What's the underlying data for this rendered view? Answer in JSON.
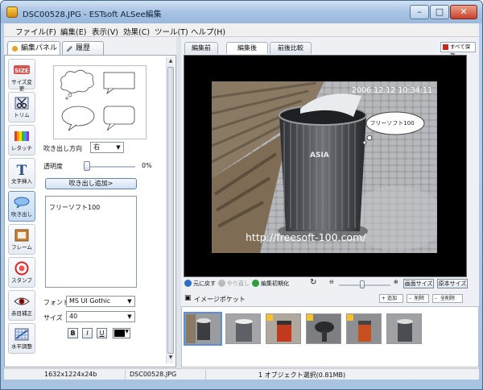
{
  "window": {
    "title": "DSC00528.JPG - ESTsoft ALSee編集",
    "buttons": {
      "minimize": "–",
      "maximize": "□",
      "close": "✕"
    }
  },
  "menu": [
    "ファイル(F)",
    "編集(E)",
    "表示(V)",
    "効果(C)",
    "ツール(T)",
    "ヘルプ(H)"
  ],
  "left_tabs": [
    {
      "label": "編集パネル",
      "active": true
    },
    {
      "label": "履歴",
      "active": false
    }
  ],
  "tools": [
    {
      "label": "サイズ変更",
      "icon": "size-icon"
    },
    {
      "label": "トリム",
      "icon": "scissors-icon"
    },
    {
      "label": "レタッチ",
      "icon": "color-bars-icon"
    },
    {
      "label": "文字挿入",
      "icon": "text-t-icon"
    },
    {
      "label": "吹き出し",
      "icon": "speech-balloon-icon"
    },
    {
      "label": "フレーム",
      "icon": "frame-icon"
    },
    {
      "label": "スタンプ",
      "icon": "stamp-icon"
    },
    {
      "label": "赤目補正",
      "icon": "eye-icon"
    },
    {
      "label": "水平調整",
      "icon": "level-grid-icon"
    }
  ],
  "balloon_options": {
    "direction_label": "吹き出し方向",
    "direction_value": "右",
    "opacity_label": "透明度",
    "opacity_value": "0%",
    "opacity_level": 0,
    "add_button": "吹き出し追加>",
    "text": "フリーソフト100",
    "font_label": "フォント",
    "font_value": "MS UI Gothic",
    "size_label": "サイズ",
    "size_value": "40",
    "bold": "B",
    "italic": "I",
    "underline": "U",
    "color": "#000000"
  },
  "view_tabs": [
    {
      "label": "編集前",
      "active": false
    },
    {
      "label": "編集後",
      "active": true
    },
    {
      "label": "前後比較",
      "active": false
    }
  ],
  "save_all": "すべて保存",
  "photo": {
    "datestamp": "2006.12.12  10:34:11",
    "bubble_text": "フリーソフト100",
    "watermark": "http://freesoft-100.com/"
  },
  "viewbar": {
    "undo": "元に戻す",
    "redo": "やり直し",
    "reset": "編集初期化",
    "fit": "画面サイズ",
    "original": "原本サイズ"
  },
  "pocket": {
    "title": "イメージポケット",
    "add": "追加",
    "delete": "削除",
    "delete_all": "全削除"
  },
  "status": {
    "dimensions": "1632x1224x24b",
    "filename": "DSC00528.JPG",
    "selection": "1 オブジェクト選択(0.81MB)"
  },
  "colors": {
    "accent": "#5c8fd6",
    "title_bg": "#a8c3e3",
    "close": "#c8412a"
  }
}
